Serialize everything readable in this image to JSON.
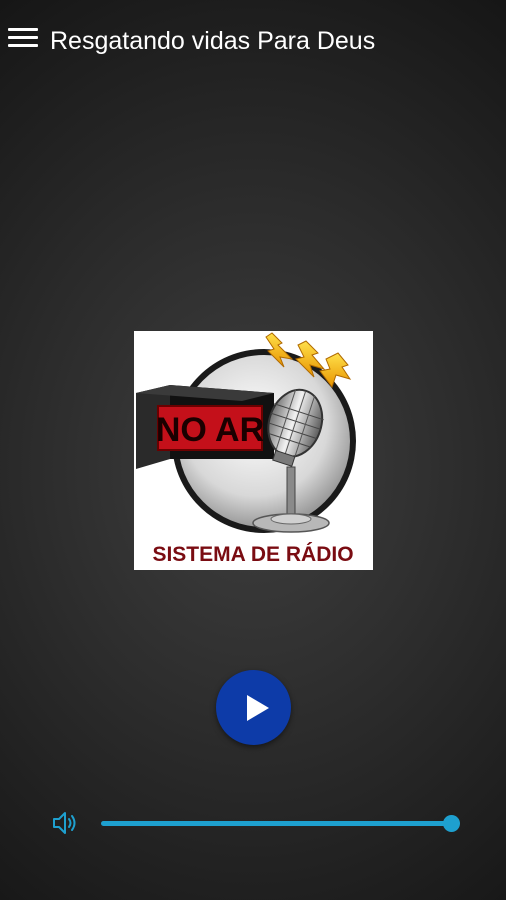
{
  "app_bar": {
    "title": "Resgatando vidas Para Deus",
    "menu_icon": "hamburger-menu-icon"
  },
  "logo": {
    "sign_text": "NO AR",
    "caption": "SISTEMA DE RÁDIO"
  },
  "player": {
    "play_icon": "play-icon",
    "volume_icon": "speaker-volume-icon",
    "volume_level": 1.0,
    "accent_color": "#1ea0cf",
    "play_button_color": "#0d3ba8"
  }
}
